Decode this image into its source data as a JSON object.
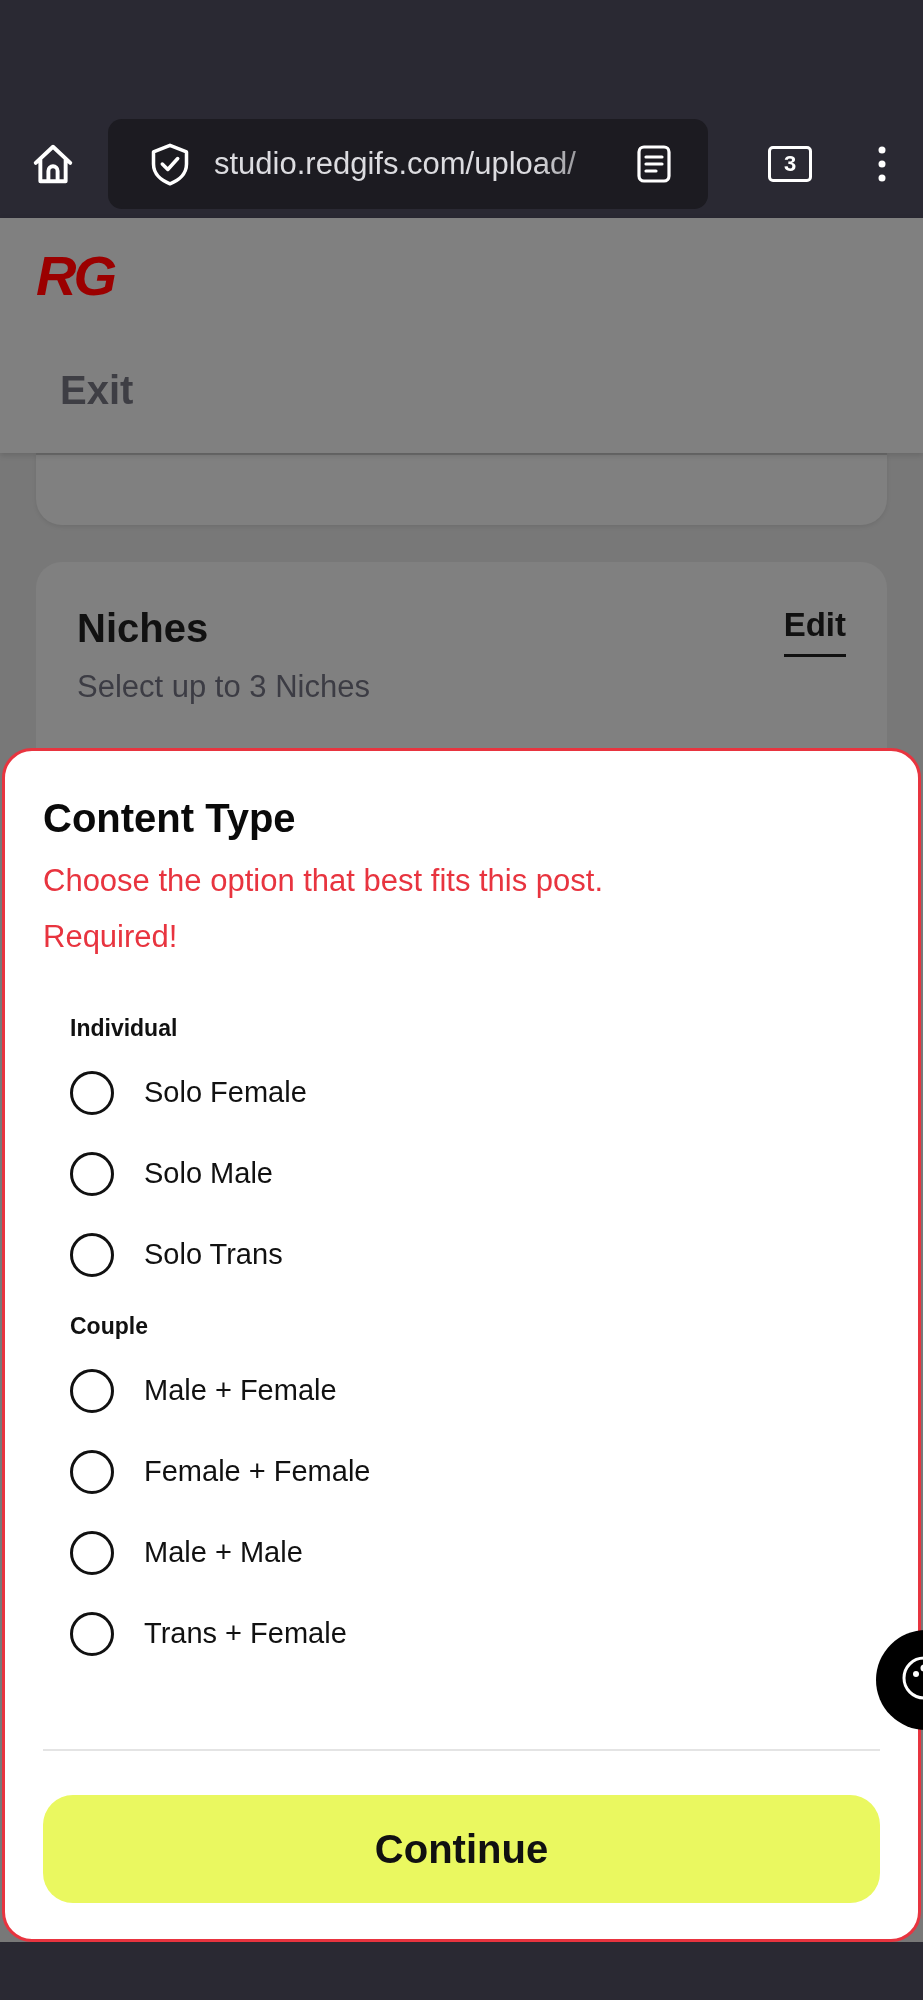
{
  "browser": {
    "url": "studio.redgifs.com/upload/",
    "tab_count": "3"
  },
  "header": {
    "logo": "RG",
    "exit": "Exit"
  },
  "niches_card": {
    "title": "Niches",
    "edit": "Edit",
    "subtitle": "Select up to 3 Niches"
  },
  "sheet": {
    "title": "Content Type",
    "hint": "Choose the option that best fits this post.",
    "error": "Required!",
    "groups": [
      {
        "label": "Individual",
        "options": [
          {
            "label": "Solo Female",
            "selected": false
          },
          {
            "label": "Solo Male",
            "selected": false
          },
          {
            "label": "Solo Trans",
            "selected": false
          }
        ]
      },
      {
        "label": "Couple",
        "options": [
          {
            "label": "Male + Female",
            "selected": false
          },
          {
            "label": "Female + Female",
            "selected": false
          },
          {
            "label": "Male + Male",
            "selected": false
          },
          {
            "label": "Trans + Female",
            "selected": false
          }
        ]
      }
    ],
    "button": "Continue"
  }
}
